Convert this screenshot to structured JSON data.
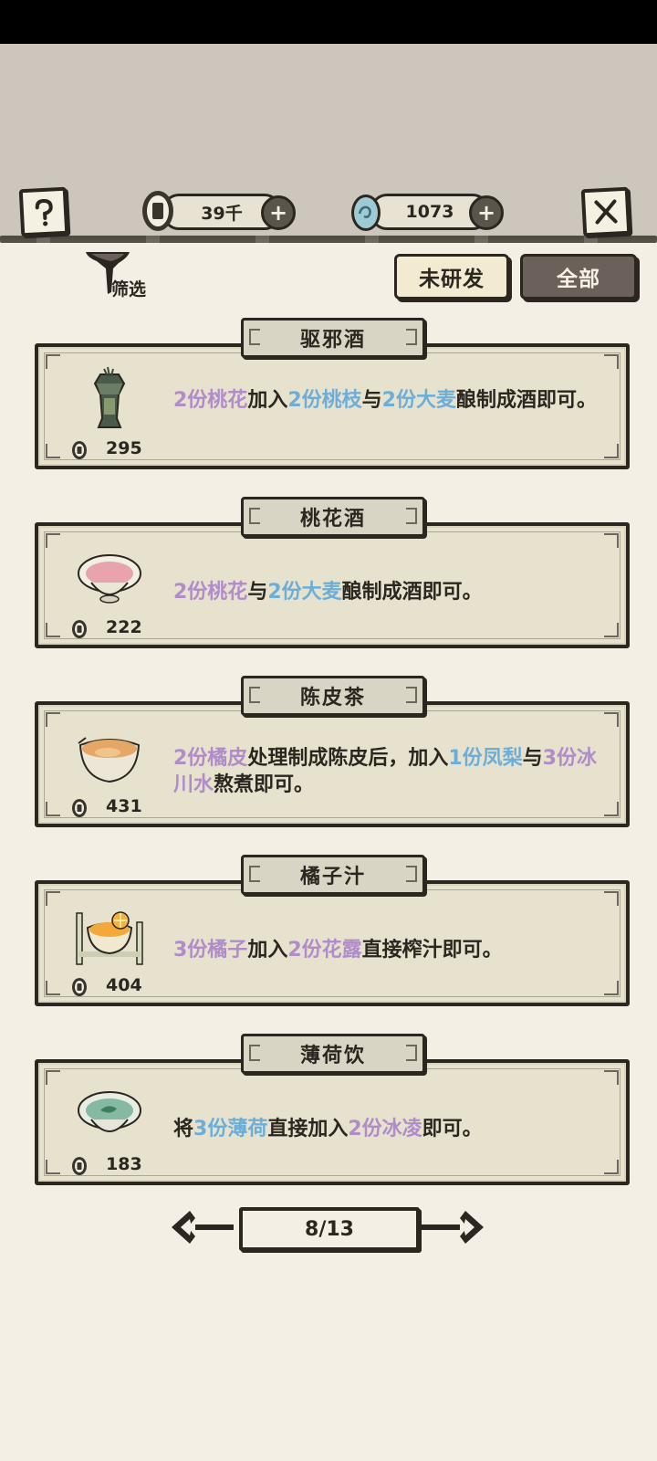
{
  "header": {
    "coins": {
      "value": "39千",
      "icon": "copper-coin-icon"
    },
    "gems": {
      "value": "1073",
      "icon": "jade-egg-icon"
    },
    "help_icon": "question-icon",
    "close_icon": "close-x-icon",
    "plus_symbol": "+"
  },
  "filter": {
    "label": "筛选",
    "icon": "funnel-icon"
  },
  "tabs": {
    "unresearched": "未研发",
    "all": "全部"
  },
  "recipes": [
    {
      "name": "驱邪酒",
      "price": "295",
      "icon": "lantern-jar-icon",
      "desc": [
        {
          "t": "2份桃花",
          "c": "p"
        },
        {
          "t": "加入",
          "c": ""
        },
        {
          "t": "2份桃枝",
          "c": "b"
        },
        {
          "t": "与",
          "c": ""
        },
        {
          "t": "2份大麦",
          "c": "b"
        },
        {
          "t": "酿制成酒即可。",
          "c": ""
        }
      ]
    },
    {
      "name": "桃花酒",
      "price": "222",
      "icon": "pink-bowl-icon",
      "desc": [
        {
          "t": "2份桃花",
          "c": "p"
        },
        {
          "t": "与",
          "c": ""
        },
        {
          "t": "2份大麦",
          "c": "b"
        },
        {
          "t": "酿制成酒即可。",
          "c": ""
        }
      ]
    },
    {
      "name": "陈皮茶",
      "price": "431",
      "icon": "tea-bowl-icon",
      "desc": [
        {
          "t": "2份橘皮",
          "c": "p"
        },
        {
          "t": "处理制成陈皮后，加入",
          "c": ""
        },
        {
          "t": "1份凤梨",
          "c": "b"
        },
        {
          "t": "与",
          "c": ""
        },
        {
          "t": "3份冰川水",
          "c": "p"
        },
        {
          "t": "熬煮即可。",
          "c": ""
        }
      ]
    },
    {
      "name": "橘子汁",
      "price": "404",
      "icon": "juice-bowl-icon",
      "desc": [
        {
          "t": "3份橘子",
          "c": "p"
        },
        {
          "t": "加入",
          "c": ""
        },
        {
          "t": "2份花露",
          "c": "p"
        },
        {
          "t": "直接榨汁即可。",
          "c": ""
        }
      ]
    },
    {
      "name": "薄荷饮",
      "price": "183",
      "icon": "mint-bowl-icon",
      "desc": [
        {
          "t": "将",
          "c": ""
        },
        {
          "t": "3份薄荷",
          "c": "b"
        },
        {
          "t": "直接加入",
          "c": ""
        },
        {
          "t": "2份冰凌",
          "c": "p"
        },
        {
          "t": "即可。",
          "c": ""
        }
      ]
    }
  ],
  "pager": {
    "label": "8/13"
  },
  "colors": {
    "purple": "#b08cc9",
    "blue": "#6daed8",
    "ink": "#2b2620",
    "paper": "#e7e2cd"
  }
}
